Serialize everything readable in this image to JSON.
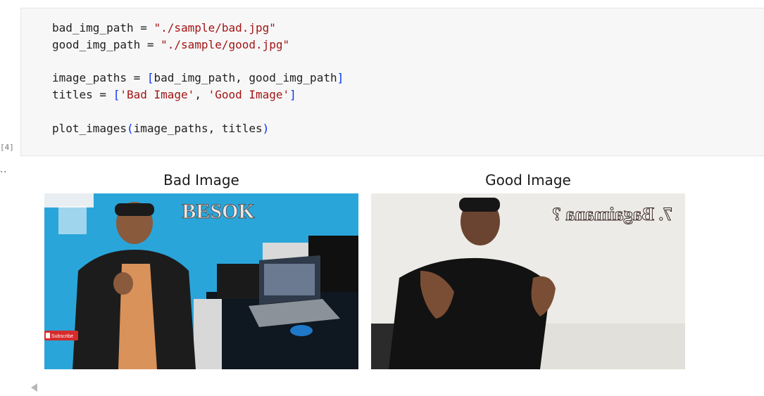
{
  "cell": {
    "execution_count": "[4]",
    "output_prompt": "..",
    "code_lines": [
      [
        {
          "t": "bad_img_path = ",
          "c": ""
        },
        {
          "t": "\"./sample/bad.jpg\"",
          "c": "str"
        }
      ],
      [
        {
          "t": "good_img_path = ",
          "c": ""
        },
        {
          "t": "\"./sample/good.jpg\"",
          "c": "str"
        }
      ],
      [],
      [
        {
          "t": "image_paths = ",
          "c": ""
        },
        {
          "t": "[",
          "c": "brk"
        },
        {
          "t": "bad_img_path, good_img_path",
          "c": ""
        },
        {
          "t": "]",
          "c": "brk"
        }
      ],
      [
        {
          "t": "titles = ",
          "c": ""
        },
        {
          "t": "[",
          "c": "brk"
        },
        {
          "t": "'Bad Image'",
          "c": "str"
        },
        {
          "t": ", ",
          "c": ""
        },
        {
          "t": "'Good Image'",
          "c": "str"
        },
        {
          "t": "]",
          "c": "brk"
        }
      ],
      [],
      [
        {
          "t": "plot_images",
          "c": ""
        },
        {
          "t": "(",
          "c": "brk"
        },
        {
          "t": "image_paths, titles",
          "c": ""
        },
        {
          "t": ")",
          "c": "brk"
        }
      ]
    ]
  },
  "output": {
    "panels": [
      {
        "title": "Bad Image",
        "overlay_text": "BESOK",
        "badge_text": "Subscribe"
      },
      {
        "title": "Good Image",
        "overlay_text": "7. Bagaimana ?"
      }
    ]
  }
}
